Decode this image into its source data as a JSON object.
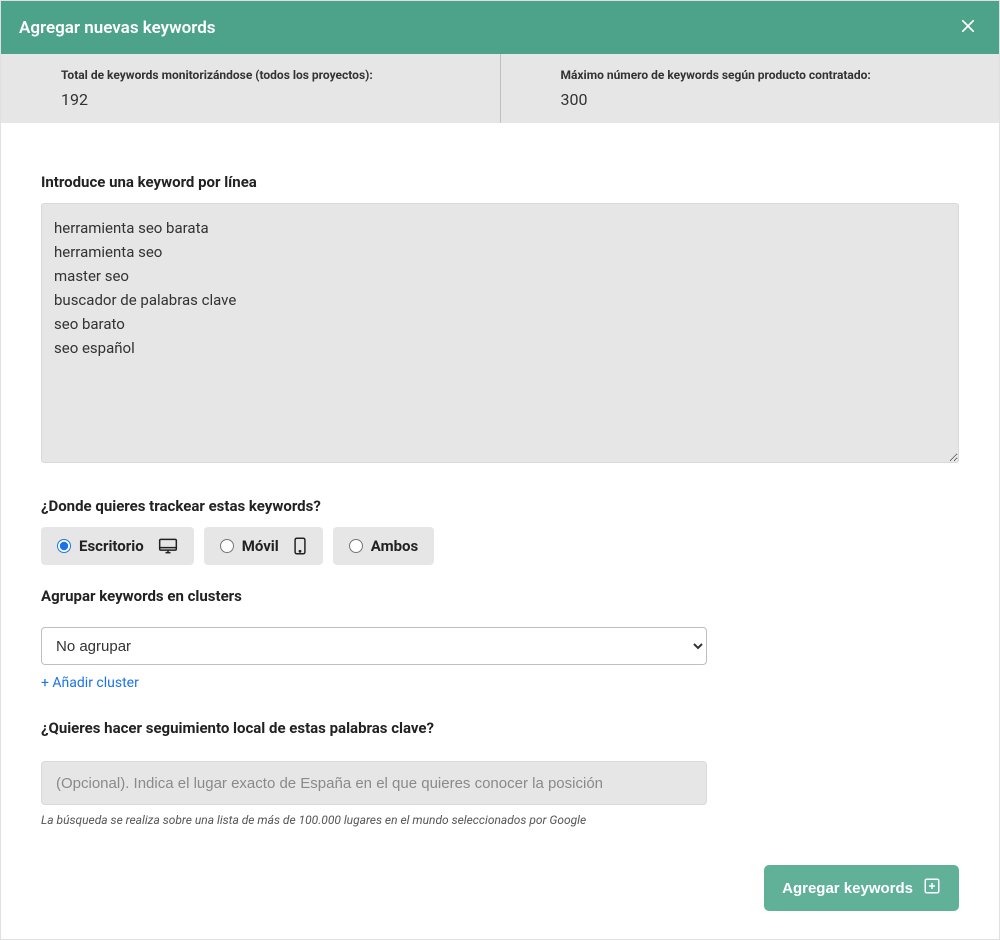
{
  "header": {
    "title": "Agregar nuevas keywords"
  },
  "stats": {
    "total_label": "Total de keywords monitorizándose (todos los proyectos):",
    "total_value": "192",
    "max_label": "Máximo número de keywords según producto contratado:",
    "max_value": "300"
  },
  "keywords": {
    "label": "Introduce una keyword por línea",
    "value": "herramienta seo barata\nherramienta seo\nmaster seo\nbuscador de palabras clave\nseo barato\nseo español"
  },
  "track": {
    "label": "¿Donde quieres trackear estas keywords?",
    "options": {
      "desktop": "Escritorio",
      "mobile": "Móvil",
      "both": "Ambos"
    },
    "selected": "desktop"
  },
  "cluster": {
    "label": "Agrupar keywords en clusters",
    "selected": "No agrupar",
    "options": [
      "No agrupar"
    ],
    "add_link": "+ Añadir cluster"
  },
  "local": {
    "label": "¿Quieres hacer seguimiento local de estas palabras clave?",
    "placeholder": "(Opcional). Indica el lugar exacto de España en el que quieres conocer la posición",
    "help": "La búsqueda se realiza sobre una lista de más de 100.000 lugares en el mundo seleccionados por Google"
  },
  "footer": {
    "submit": "Agregar keywords"
  }
}
